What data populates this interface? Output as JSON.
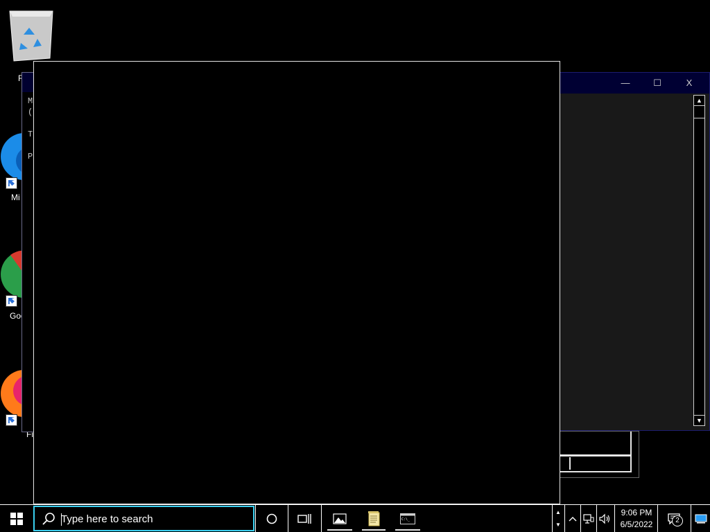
{
  "desktop": {
    "icons": [
      {
        "name": "Recycle Bin",
        "label": "R"
      },
      {
        "name": "Microsoft Edge",
        "label": "Mi"
      },
      {
        "name": "Google Chrome",
        "label": "Goo"
      },
      {
        "name": "Firefox",
        "label": "Fi"
      }
    ]
  },
  "back_window": {
    "lines": [
      "M",
      "(",
      "T",
      "P"
    ]
  },
  "right_window": {
    "minimize_glyph": "—",
    "maximize_glyph": "☐",
    "close_glyph": "X",
    "scroll_up": "▲",
    "scroll_down": "▼"
  },
  "taskbar": {
    "search_placeholder": "Type here to search",
    "clock_time": "9:06 PM",
    "clock_date": "6/5/2022",
    "notification_count": "2",
    "overflow_up": "▲",
    "overflow_down": "▼",
    "volume_glyph": "🔊"
  },
  "colors": {
    "search_border": "#3ad0f0",
    "console_title": "#000033",
    "console_body": "#191919"
  }
}
